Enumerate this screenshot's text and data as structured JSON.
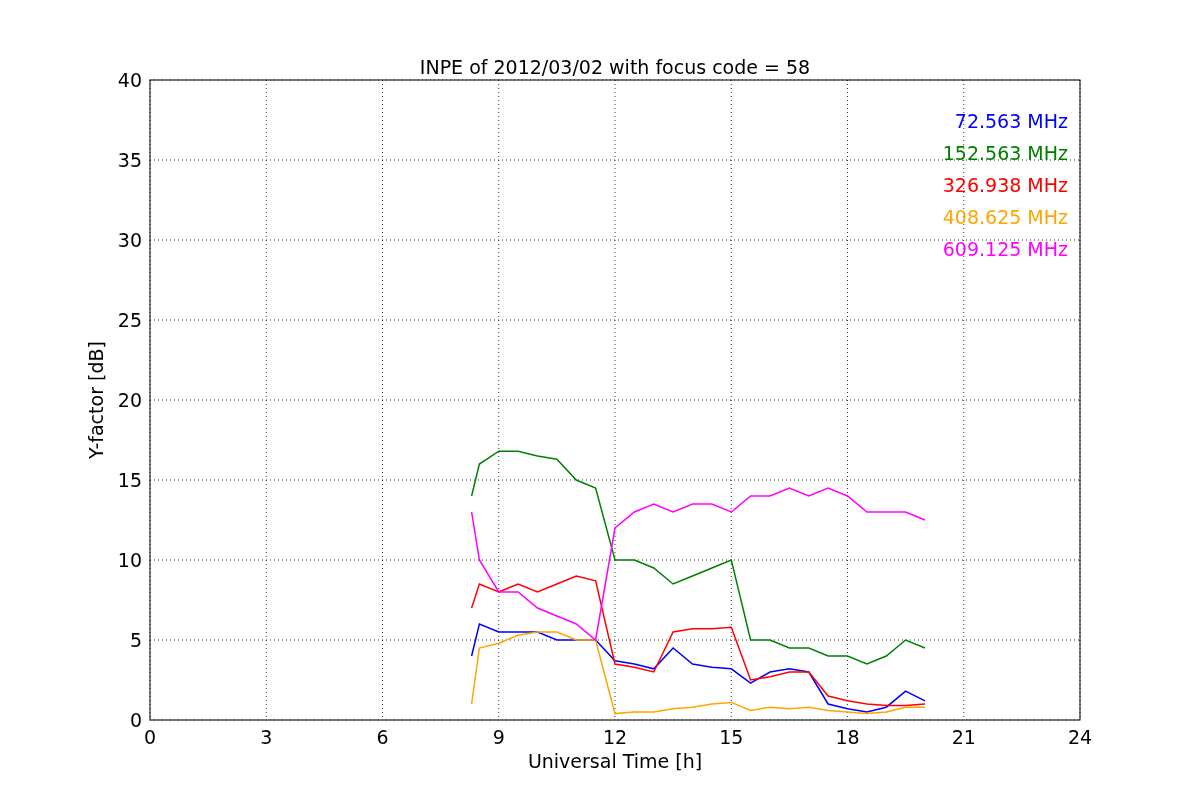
{
  "figure": {
    "chart_data": {
      "type": "line",
      "title": "INPE of 2012/03/02 with focus code = 58",
      "xlabel": "Universal Time [h]",
      "ylabel": "Y-factor [dB]",
      "x": [
        8.3,
        8.5,
        9,
        9.5,
        10,
        10.5,
        11,
        11.5,
        12,
        12.5,
        13,
        13.5,
        14,
        14.5,
        15,
        15.5,
        16,
        16.5,
        17,
        17.5,
        18,
        18.5,
        19,
        19.5,
        20
      ],
      "series": [
        {
          "name": "72.563 MHz",
          "color": "#0000ff",
          "values": [
            4,
            6,
            5.5,
            5.5,
            5.5,
            5,
            5,
            5,
            3.7,
            3.5,
            3.2,
            4.5,
            3.5,
            3.3,
            3.2,
            2.3,
            3,
            3.2,
            3,
            1,
            0.7,
            0.5,
            0.8,
            1.8,
            1.2
          ]
        },
        {
          "name": "152.563 MHz",
          "color": "#008000",
          "values": [
            14,
            16,
            16.8,
            16.8,
            16.5,
            16.3,
            15,
            14.5,
            10,
            10,
            9.5,
            8.5,
            9,
            9.5,
            10,
            5,
            5,
            4.5,
            4.5,
            4,
            4,
            3.5,
            4,
            5,
            4.5
          ]
        },
        {
          "name": "326.938 MHz",
          "color": "#ff0000",
          "values": [
            7,
            8.5,
            8,
            8.5,
            8,
            8.5,
            9,
            8.7,
            3.5,
            3.3,
            3,
            5.5,
            5.7,
            5.7,
            5.8,
            2.5,
            2.7,
            3,
            3,
            1.5,
            1.2,
            1,
            0.9,
            0.9,
            1
          ]
        },
        {
          "name": "408.625 MHz",
          "color": "#ffa500",
          "values": [
            1,
            4.5,
            4.8,
            5.3,
            5.5,
            5.5,
            5,
            5,
            0.4,
            0.5,
            0.5,
            0.7,
            0.8,
            1,
            1.1,
            0.6,
            0.8,
            0.7,
            0.8,
            0.6,
            0.5,
            0.4,
            0.5,
            0.8,
            0.8
          ]
        },
        {
          "name": "609.125 MHz",
          "color": "#ff00ff",
          "values": [
            13,
            10,
            8,
            8,
            7,
            6.5,
            6,
            5,
            12,
            13,
            13.5,
            13,
            13.5,
            13.5,
            13,
            14,
            14,
            14.5,
            14,
            14.5,
            14,
            13,
            13,
            13,
            12.5
          ]
        }
      ],
      "xlim": [
        0,
        24
      ],
      "ylim": [
        0,
        40
      ],
      "xticks": [
        0,
        3,
        6,
        9,
        12,
        15,
        18,
        21,
        24
      ],
      "yticks": [
        0,
        5,
        10,
        15,
        20,
        25,
        30,
        35,
        40
      ],
      "grid": true
    }
  }
}
